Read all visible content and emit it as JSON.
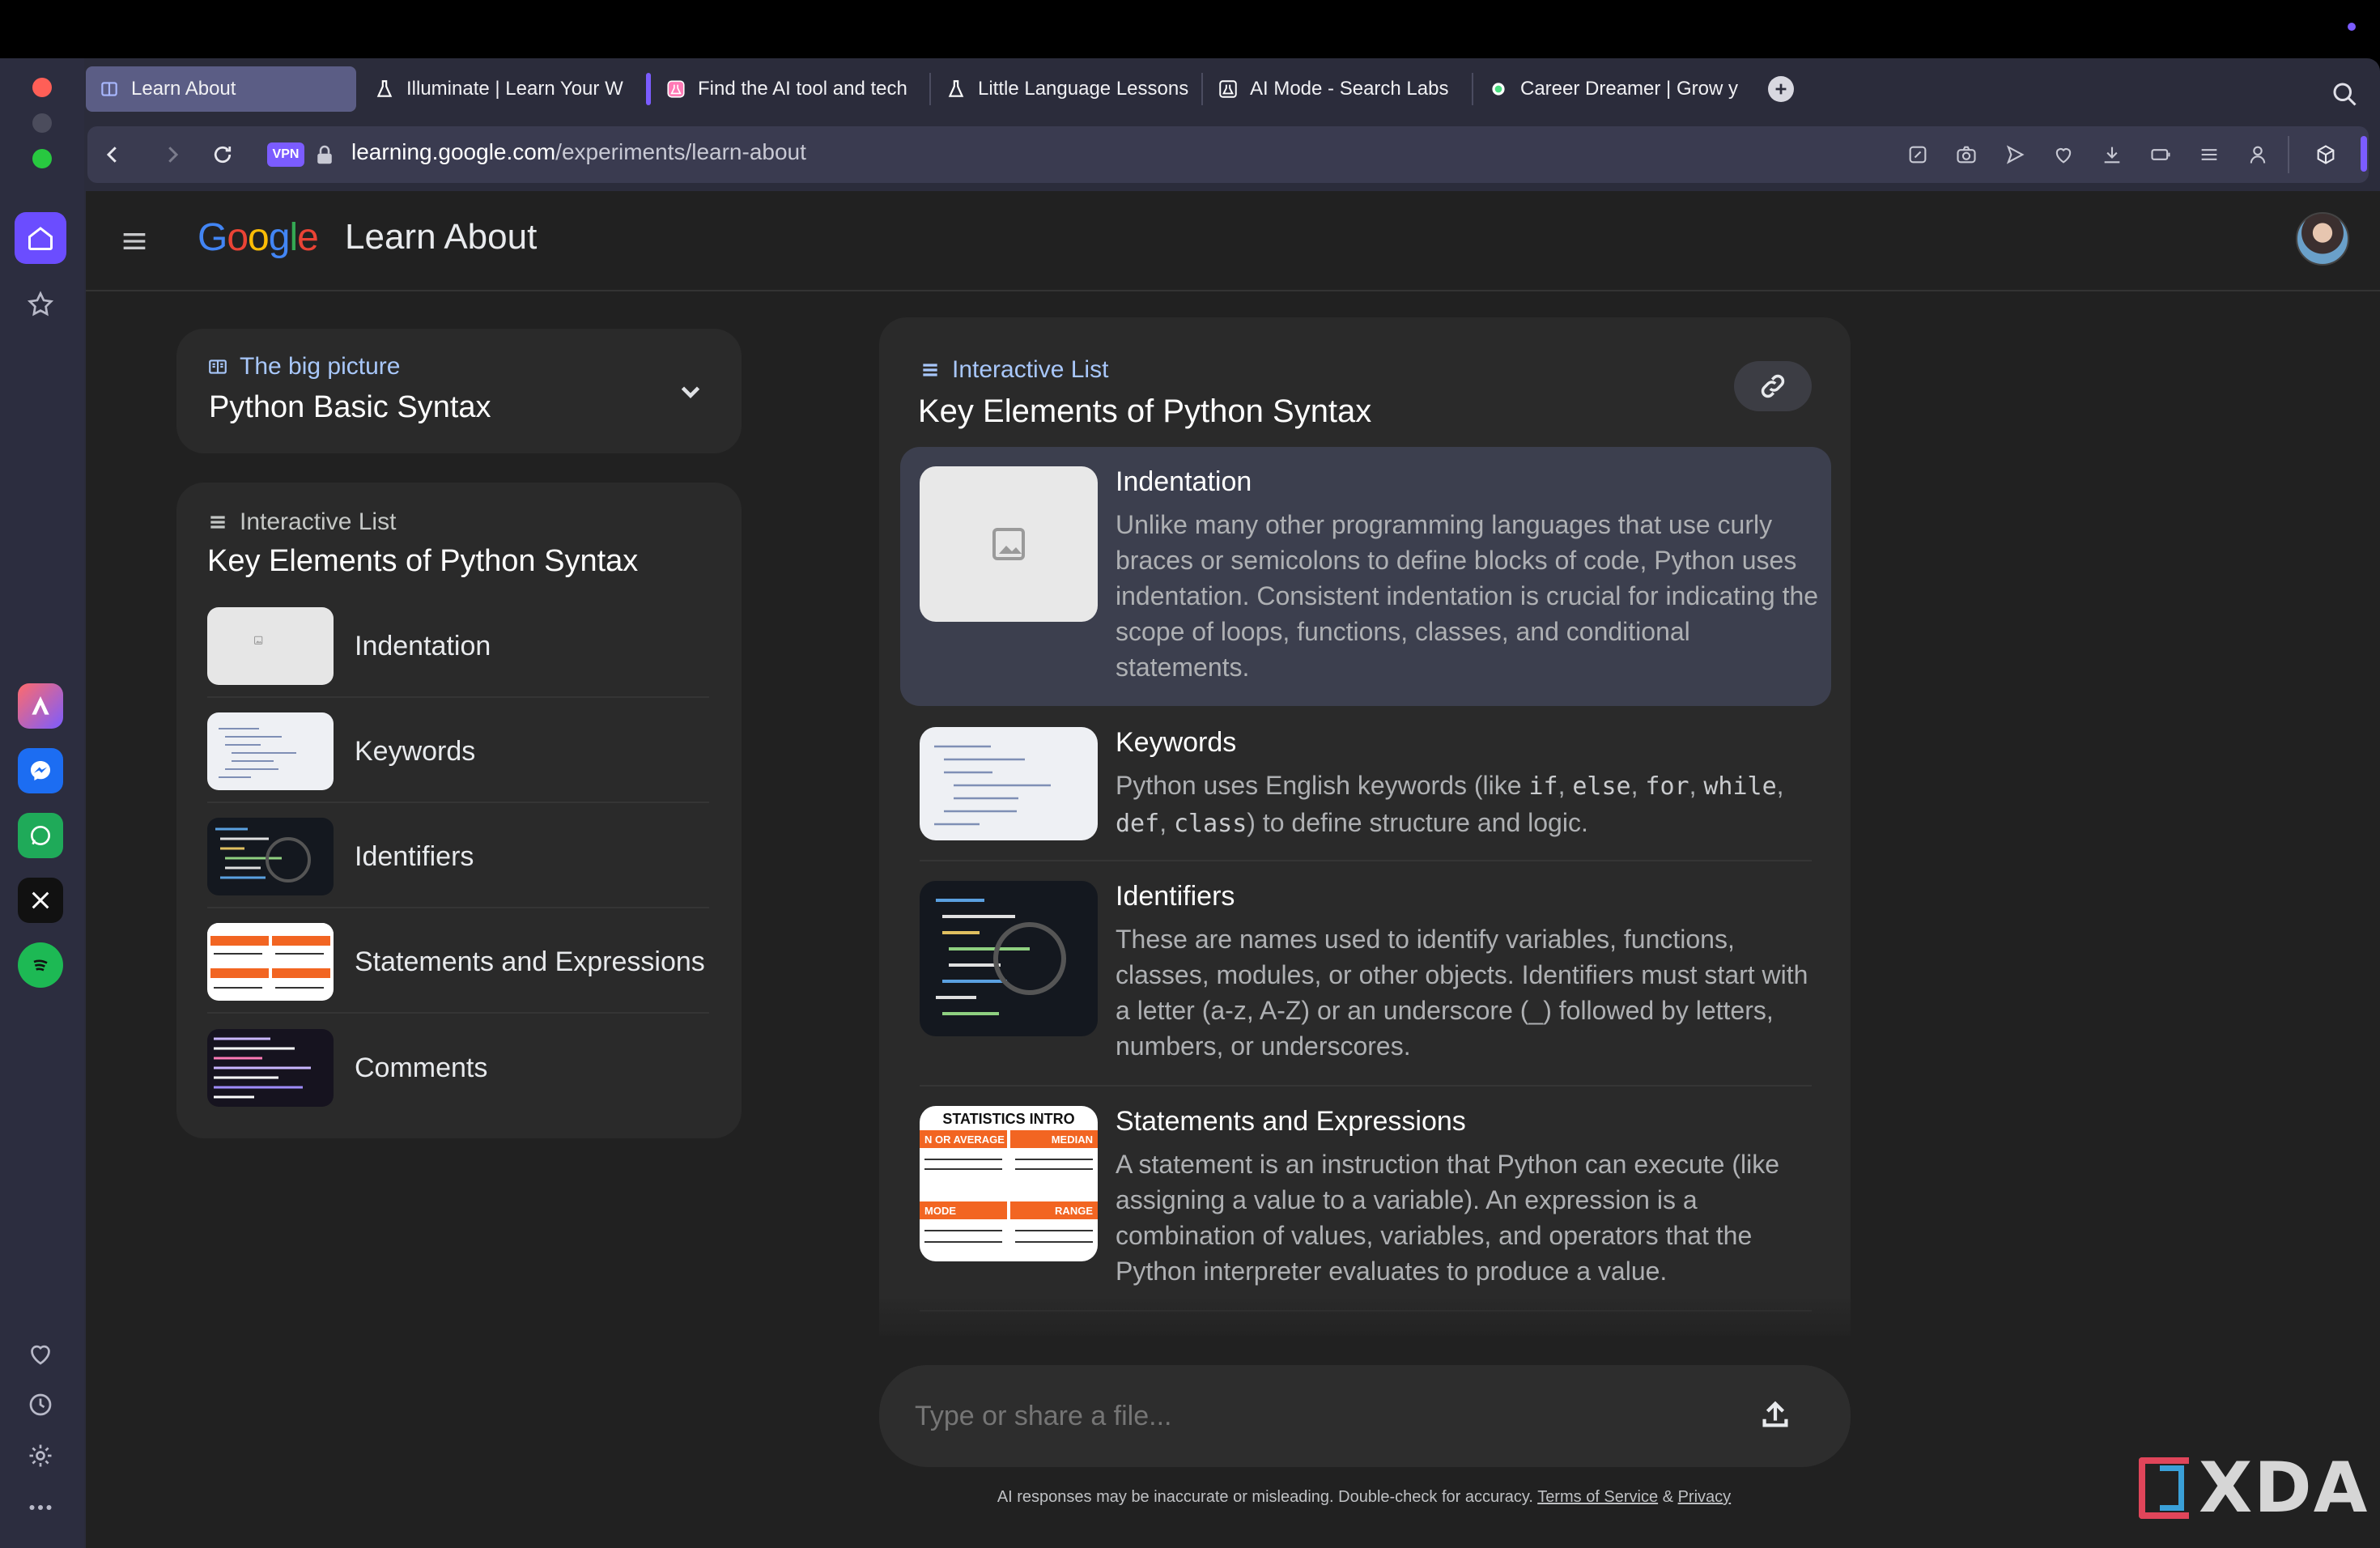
{
  "browser": {
    "tabs": [
      {
        "title": "Learn About",
        "icon": "book-icon",
        "active": true
      },
      {
        "title": "Illuminate | Learn Your W",
        "icon": "flask-icon"
      },
      {
        "title": "Find the AI tool and tech",
        "icon": "flask-icon"
      },
      {
        "title": "Little Language Lessons",
        "icon": "flask-icon"
      },
      {
        "title": "AI Mode - Search Labs",
        "icon": "flask-icon"
      },
      {
        "title": "Career Dreamer | Grow y",
        "icon": "dot-icon"
      }
    ],
    "address": {
      "vpn_label": "VPN",
      "url_domain": "learning.google.com",
      "url_path": "/experiments/learn-about"
    },
    "accent_color": "#7b5cff"
  },
  "app": {
    "logo_text": "Google",
    "title": "Learn About"
  },
  "big_picture": {
    "label": "The big picture",
    "topic": "Python Basic Syntax"
  },
  "left_list": {
    "header": "Interactive List",
    "title": "Key Elements of Python Syntax",
    "items": [
      {
        "label": "Indentation",
        "thumb": "placeholder"
      },
      {
        "label": "Keywords",
        "thumb": "code-light"
      },
      {
        "label": "Identifiers",
        "thumb": "code-dark"
      },
      {
        "label": "Statements and Expressions",
        "thumb": "statistics"
      },
      {
        "label": "Comments",
        "thumb": "code-purple"
      }
    ]
  },
  "main_list": {
    "header": "Interactive List",
    "title": "Key Elements of Python Syntax",
    "items": [
      {
        "title": "Indentation",
        "body": "Unlike many other programming languages that use curly braces or semicolons to define blocks of code, Python uses indentation. Consistent indentation is crucial for indicating the scope of loops, functions, classes, and conditional statements."
      },
      {
        "title": "Keywords",
        "body_prefix": "Python uses English keywords (like ",
        "keywords": [
          "if",
          "else",
          "for",
          "while",
          "def",
          "class"
        ],
        "body_suffix": ") to define structure and logic."
      },
      {
        "title": "Identifiers",
        "body": "These are names used to identify variables, functions, classes, modules, or other objects. Identifiers must start with a letter (a-z, A-Z) or an underscore (_) followed by letters, numbers, or underscores."
      },
      {
        "title": "Statements and Expressions",
        "body": "A statement is an instruction that Python can execute (like assigning a value to a variable). An expression is a combination of values, variables, and operators that the Python interpreter evaluates to produce a value."
      }
    ],
    "statistics_thumb": {
      "heading": "STATISTICS INTRO",
      "label_mean": "N OR AVERAGE",
      "label_median": "MEDIAN",
      "label_mode": "MODE",
      "label_range": "RANGE"
    }
  },
  "composer": {
    "placeholder": "Type or share a file..."
  },
  "footer": {
    "disclaimer": "AI responses may be inaccurate or misleading. Double-check for accuracy.",
    "terms": "Terms of Service",
    "amp": "&",
    "privacy": "Privacy"
  },
  "watermark": "XDA"
}
